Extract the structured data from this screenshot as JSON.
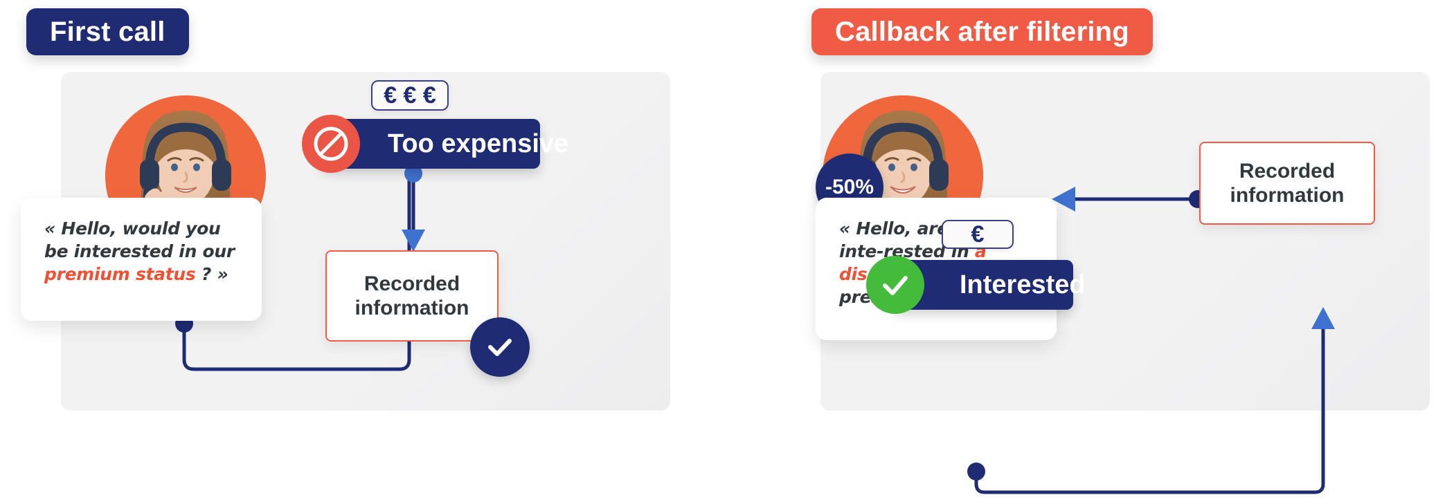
{
  "panels": [
    {
      "id": "first-call",
      "title": "First call",
      "title_color": "#1f2b73",
      "quote": {
        "plain_before": "« Hello, would you be interested in our ",
        "highlight": "premium status",
        "plain_after": " ? »",
        "highlight_color": "#ef5134"
      },
      "euro_badge": "€ € €",
      "euro_count": 3,
      "status": {
        "label": "Too expensive",
        "icon": "deny-icon",
        "icon_color": "#ea5546",
        "banner_color": "#1f2b73"
      },
      "recorded": "Recorded information",
      "recorded_line_1": "Recorded",
      "recorded_line_2": "information",
      "check_icon": "check-icon"
    },
    {
      "id": "callback-after-filtering",
      "title": "Callback after filtering",
      "title_color": "#ef5b45",
      "discount_badge": "-50%",
      "quote": {
        "plain_before": "« Hello, are you inte-rested in ",
        "highlight": "a discount",
        "plain_after": " on our premium status? »",
        "highlight_color": "#ef5134"
      },
      "euro_badge": "€",
      "euro_count": 1,
      "status": {
        "label": "Interested",
        "icon": "check-icon",
        "icon_color": "#45bb3b",
        "banner_color": "#1f2b73"
      },
      "recorded": "Recorded information",
      "recorded_line_1": "Recorded",
      "recorded_line_2": "information"
    }
  ],
  "colors": {
    "navy": "#1f2b73",
    "coral": "#ef5b45",
    "orange_accent": "#f0673d",
    "green": "#45bb3b",
    "blue_arrow": "#3f72d0",
    "text_dark": "#32393d",
    "panel_grey": "#f2f2f3"
  },
  "icons": {
    "deny": "deny-icon",
    "check": "check-icon",
    "arrow_down": "arrow-down-icon",
    "arrow_up": "arrow-up-icon",
    "arrow_left": "arrow-left-icon"
  }
}
